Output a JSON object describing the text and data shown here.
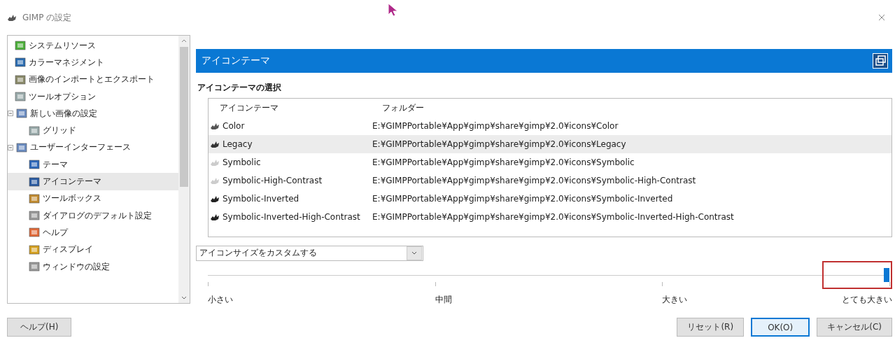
{
  "window": {
    "title": "GIMP の設定"
  },
  "sidebar": {
    "items": [
      {
        "label": "システムリソース",
        "selected": false
      },
      {
        "label": "カラーマネジメント",
        "selected": false
      },
      {
        "label": "画像のインポートとエクスポート",
        "selected": false
      },
      {
        "label": "ツールオプション",
        "selected": false
      },
      {
        "label": "新しい画像の設定",
        "selected": false,
        "expanded": true,
        "children": [
          {
            "label": "グリッド",
            "selected": false
          }
        ]
      },
      {
        "label": "ユーザーインターフェース",
        "selected": false,
        "expanded": true,
        "children": [
          {
            "label": "テーマ",
            "selected": false
          },
          {
            "label": "アイコンテーマ",
            "selected": true
          },
          {
            "label": "ツールボックス",
            "selected": false
          },
          {
            "label": "ダイアログのデフォルト設定",
            "selected": false
          },
          {
            "label": "ヘルプ",
            "selected": false
          },
          {
            "label": "ディスプレイ",
            "selected": false
          },
          {
            "label": "ウィンドウの設定",
            "selected": false
          }
        ]
      }
    ]
  },
  "page": {
    "title": "アイコンテーマ",
    "section": "アイコンテーマの選択",
    "table": {
      "columns": [
        "アイコンテーマ",
        "フォルダー"
      ],
      "rows": [
        {
          "name": "Color",
          "folder": "E:¥GIMPPortable¥App¥gimp¥share¥gimp¥2.0¥icons¥Color",
          "kind": "color",
          "selected": false
        },
        {
          "name": "Legacy",
          "folder": "E:¥GIMPPortable¥App¥gimp¥share¥gimp¥2.0¥icons¥Legacy",
          "kind": "legacy",
          "selected": true
        },
        {
          "name": "Symbolic",
          "folder": "E:¥GIMPPortable¥App¥gimp¥share¥gimp¥2.0¥icons¥Symbolic",
          "kind": "light",
          "selected": false
        },
        {
          "name": "Symbolic-High-Contrast",
          "folder": "E:¥GIMPPortable¥App¥gimp¥share¥gimp¥2.0¥icons¥Symbolic-High-Contrast",
          "kind": "light",
          "selected": false
        },
        {
          "name": "Symbolic-Inverted",
          "folder": "E:¥GIMPPortable¥App¥gimp¥share¥gimp¥2.0¥icons¥Symbolic-Inverted",
          "kind": "dark",
          "selected": false
        },
        {
          "name": "Symbolic-Inverted-High-Contrast",
          "folder": "E:¥GIMPPortable¥App¥gimp¥share¥gimp¥2.0¥icons¥Symbolic-Inverted-High-Contrast",
          "kind": "dark",
          "selected": false
        }
      ]
    },
    "size_mode": {
      "value": "アイコンサイズをカスタムする"
    },
    "size_slider": {
      "level": 1,
      "ticks": [
        "小さい",
        "中間",
        "大きい",
        "とても大きい"
      ]
    }
  },
  "help_button": {
    "label": "ヘルプ(H)"
  },
  "buttons": [
    {
      "label": "リセット(R)",
      "default": false
    },
    {
      "label": "OK(O)",
      "default": true
    },
    {
      "label": "キャンセル(C)",
      "default": false
    }
  ]
}
